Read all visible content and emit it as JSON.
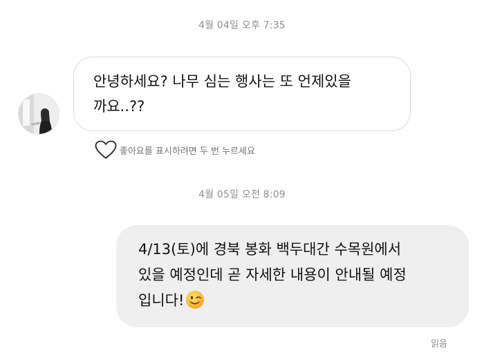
{
  "thread": {
    "timestamps": [
      "4월 04일 오후 7:35",
      "4월 05일 오전 8:09"
    ],
    "incoming_message": {
      "text": "안녕하세요? 나무 심는 행사는 또 언제있을\n까요..??",
      "like_hint": "좋아요를 표시하려면 두 번 누르세요",
      "like_icon": "heart-outline-icon"
    },
    "outgoing_message": {
      "text": "4/13(토)에 경북 봉화 백두대간 수목원에서\n있을 예정인데 곧 자세한 내용이 안내될 예정\n입니다!",
      "emoji": "winking-face-emoji"
    },
    "read_receipt": "읽음"
  },
  "colors": {
    "timestamp": "#8e8e8e",
    "incoming_border": "#dbdbdb",
    "outgoing_bg": "#efefef",
    "text": "#111111"
  }
}
